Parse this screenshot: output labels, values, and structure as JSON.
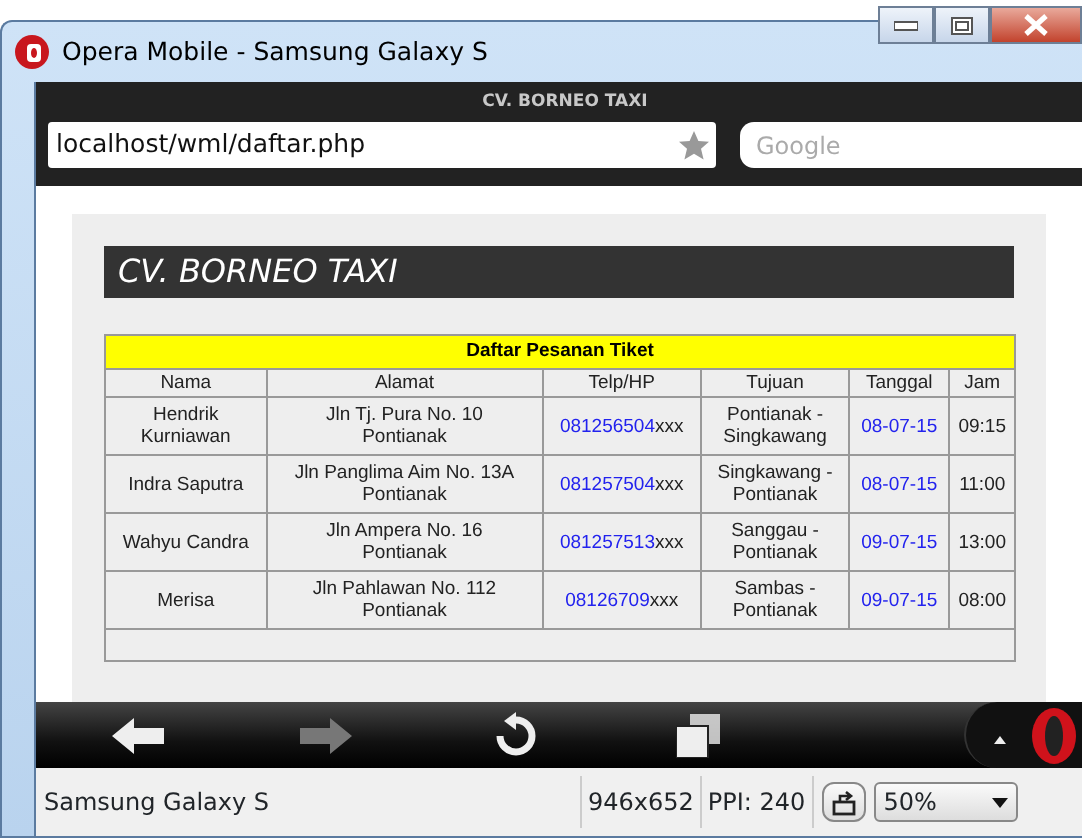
{
  "window": {
    "title": "Opera Mobile - Samsung Galaxy S"
  },
  "browser": {
    "page_title": "CV. BORNEO TAXI",
    "address": "localhost/wml/daftar.php",
    "search_placeholder": "Google"
  },
  "page": {
    "heading": "CV. BORNEO TAXI",
    "table": {
      "caption": "Daftar Pesanan Tiket",
      "columns": [
        "Nama",
        "Alamat",
        "Telp/HP",
        "Tujuan",
        "Tanggal",
        "Jam"
      ],
      "rows": [
        {
          "nama": "Hendrik\nKurniawan",
          "alamat": "Jln Tj. Pura No. 10\nPontianak",
          "telp": "081256504",
          "telp_masked": "xxx",
          "tujuan": "Pontianak -\nSingkawang",
          "tanggal": "08-07-15",
          "jam": "09:15"
        },
        {
          "nama": "Indra Saputra",
          "alamat": "Jln Panglima Aim No. 13A\nPontianak",
          "telp": "081257504",
          "telp_masked": "xxx",
          "tujuan": "Singkawang -\nPontianak",
          "tanggal": "08-07-15",
          "jam": "11:00"
        },
        {
          "nama": "Wahyu Candra",
          "alamat": "Jln Ampera No. 16\nPontianak",
          "telp": "081257513",
          "telp_masked": "xxx",
          "tujuan": "Sanggau -\nPontianak",
          "tanggal": "09-07-15",
          "jam": "13:00"
        },
        {
          "nama": "Merisa",
          "alamat": "Jln Pahlawan No. 112\nPontianak",
          "telp": "08126709",
          "telp_masked": "xxx",
          "tujuan": "Sambas -\nPontianak",
          "tanggal": "09-07-15",
          "jam": "08:00"
        }
      ]
    }
  },
  "toolbar": [
    {
      "kind": "back",
      "disabled": false
    },
    {
      "kind": "forward",
      "disabled": true
    },
    {
      "kind": "reload",
      "disabled": false
    },
    {
      "kind": "tabs",
      "disabled": false
    },
    {
      "kind": "menu",
      "disabled": false
    }
  ],
  "status_bar": {
    "device": "Samsung Galaxy S",
    "resolution": "946x652",
    "ppi": "PPI: 240",
    "zoom": "50%"
  }
}
